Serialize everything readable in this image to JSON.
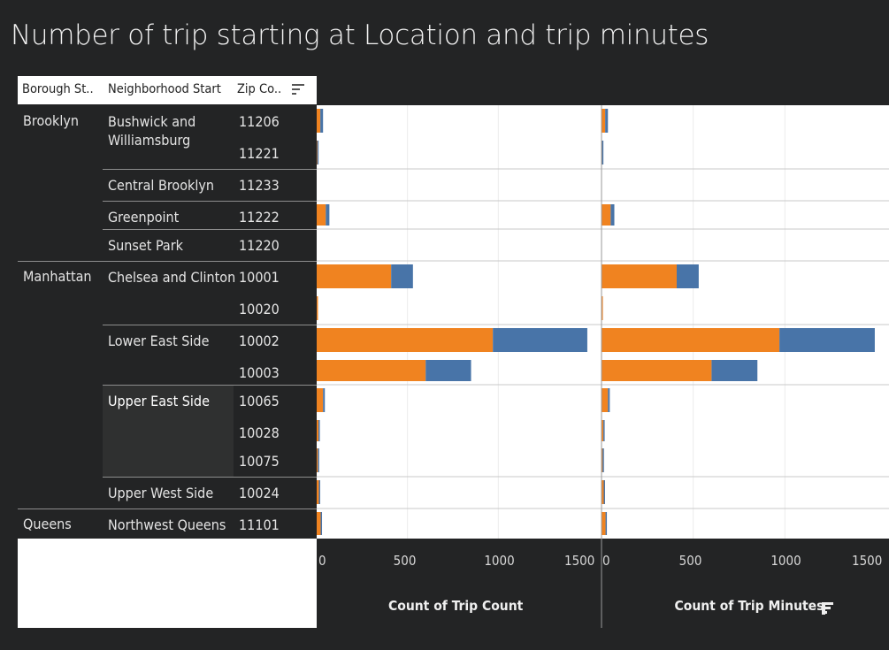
{
  "title": "Number of trip starting  at Location and trip minutes",
  "headers": {
    "borough": "Borough St..",
    "neighborhood": "Neighborhood Start",
    "zip": "Zip Co.."
  },
  "colors": {
    "orange": "#f08320",
    "blue": "#4874a8"
  },
  "boroughs": [
    "Brooklyn",
    "Manhattan",
    "Queens"
  ],
  "neighborhoods": [
    "Bushwick and\nWilliamsburg",
    "Central Brooklyn",
    "Greenpoint",
    "Sunset Park",
    "Chelsea and Clinton",
    "Lower East Side",
    "Upper East Side",
    "Upper West Side",
    "Northwest Queens"
  ],
  "chart_data": [
    {
      "type": "bar",
      "orientation": "horizontal",
      "stacked": true,
      "xlabel": "Count of Trip Count",
      "xlim": [
        0,
        1500
      ],
      "ticks": [
        "0",
        "500",
        "1000",
        "1500"
      ],
      "categories": [
        "11206",
        "11221",
        "11233",
        "11222",
        "11220",
        "10001",
        "10020",
        "10002",
        "10003",
        "10065",
        "10028",
        "10075",
        "10024",
        "11101"
      ],
      "series": [
        {
          "color": "#f08320",
          "values": [
            20,
            3,
            0,
            50,
            0,
            410,
            5,
            970,
            600,
            35,
            10,
            6,
            12,
            22
          ]
        },
        {
          "color": "#4874a8",
          "values": [
            15,
            5,
            0,
            20,
            0,
            120,
            0,
            520,
            250,
            10,
            5,
            3,
            5,
            5
          ]
        }
      ]
    },
    {
      "type": "bar",
      "orientation": "horizontal",
      "stacked": true,
      "xlabel": "Count of Trip Minutes",
      "xlim": [
        0,
        1500
      ],
      "ticks": [
        "0",
        "500",
        "1000",
        "1500"
      ],
      "categories": [
        "11206",
        "11221",
        "11233",
        "11222",
        "11220",
        "10001",
        "10020",
        "10002",
        "10003",
        "10065",
        "10028",
        "10075",
        "10024",
        "11101"
      ],
      "series": [
        {
          "color": "#f08320",
          "values": [
            20,
            3,
            0,
            50,
            0,
            410,
            5,
            970,
            600,
            35,
            10,
            6,
            12,
            22
          ]
        },
        {
          "color": "#4874a8",
          "values": [
            15,
            5,
            0,
            20,
            0,
            120,
            0,
            520,
            250,
            10,
            5,
            3,
            5,
            5
          ]
        }
      ]
    }
  ]
}
